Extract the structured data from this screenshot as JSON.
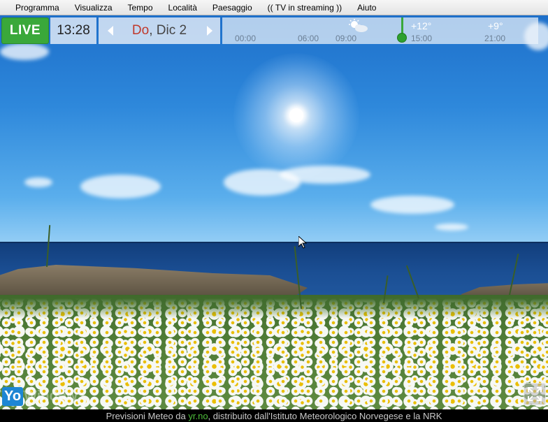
{
  "menu": {
    "items": [
      "Programma",
      "Visualizza",
      "Tempo",
      "Località",
      "Paesaggio",
      "(( TV in streaming ))",
      "Aiuto"
    ]
  },
  "topbar": {
    "live_label": "LIVE",
    "time": "13:28",
    "date_day": "Do",
    "date_rest": ", Dic 2",
    "timeline": {
      "hours": [
        "00:00",
        "06:00",
        "09:00",
        "15:00",
        "21:00"
      ],
      "temps": [
        "+12°",
        "+9°"
      ],
      "weather_icon": "partly-cloudy-icon"
    }
  },
  "logo": {
    "yo": "Yo",
    "window": "Window"
  },
  "status": {
    "prefix": "Previsioni Meteo da ",
    "link": "yr.no",
    "suffix": ", distribuito dall'Istituto Meteorologico Norvegese e la NRK"
  },
  "colors": {
    "live_green": "#3aa83a",
    "day_red": "#c0392b",
    "link_green": "#4fbf3c",
    "logo_blue": "#1d86d4"
  }
}
